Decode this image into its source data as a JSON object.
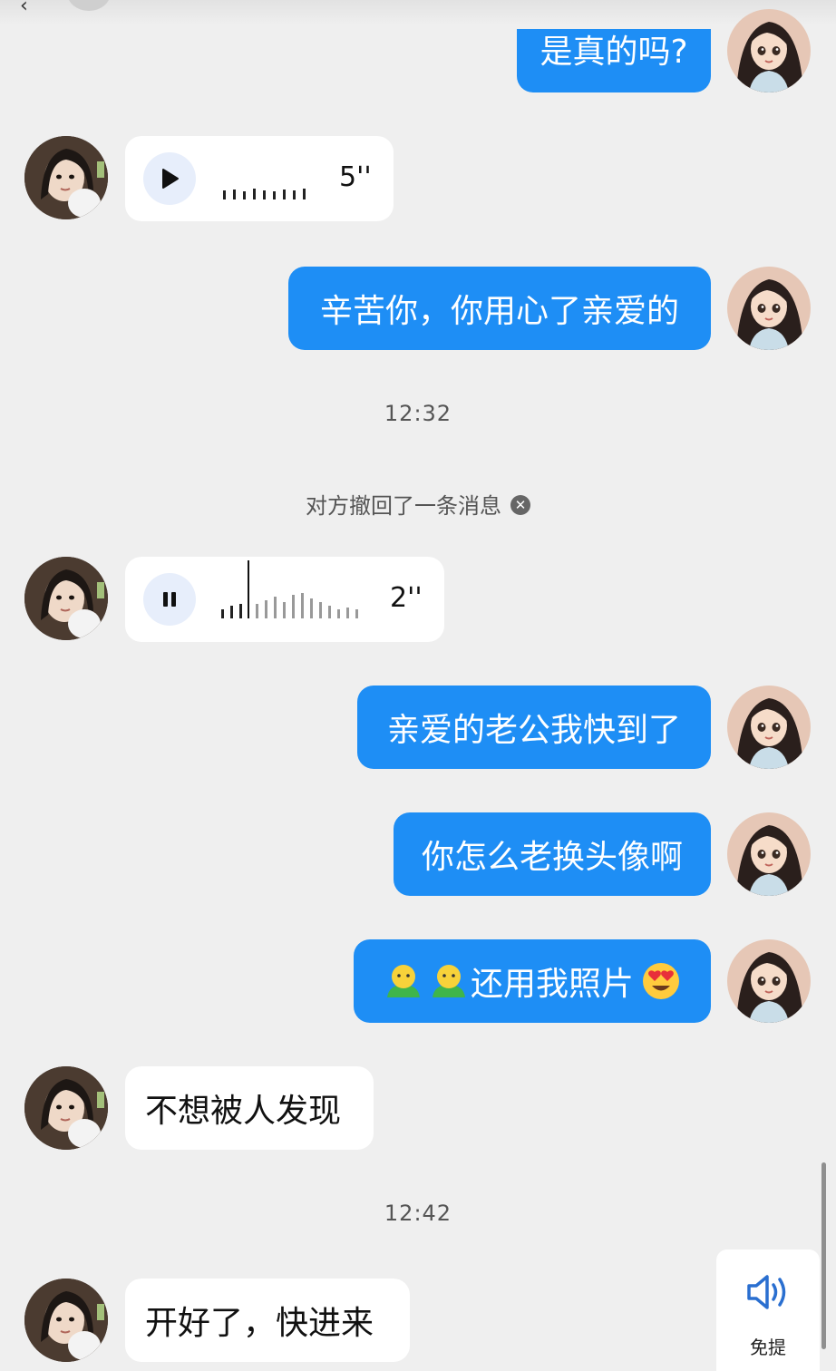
{
  "header": {
    "back_glyph": "‹"
  },
  "messages": {
    "m1": {
      "text": "是真的吗?"
    },
    "v1": {
      "duration": "5''"
    },
    "m2": {
      "text": "辛苦你，你用心了亲爱的"
    },
    "t1": {
      "time": "12:32"
    },
    "recall": {
      "text": "对方撤回了一条消息",
      "icon": "close-circle-icon"
    },
    "v2": {
      "duration": "2''",
      "progress": 0.2
    },
    "m3": {
      "text": "亲爱的老公我快到了"
    },
    "m4": {
      "text": "你怎么老换头像啊"
    },
    "m5": {
      "text": "还用我照片"
    },
    "m6": {
      "text": "不想被人发现"
    },
    "t2": {
      "time": "12:42"
    },
    "m7": {
      "text": "开好了，快进来"
    }
  },
  "speaker": {
    "label": "免提",
    "icon": "speaker-icon"
  },
  "colors": {
    "outgoing": "#1e8ef5",
    "incoming": "#ffffff",
    "background": "#efefef"
  }
}
